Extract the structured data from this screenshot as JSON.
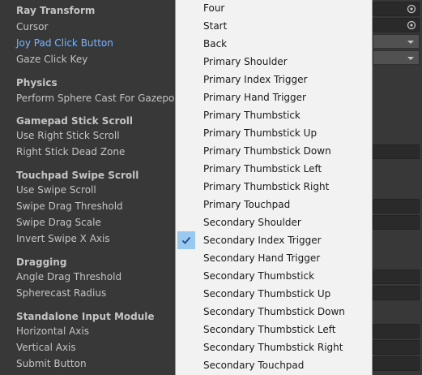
{
  "inspector": {
    "rows": [
      {
        "id": "ray-transform",
        "label": "Ray Transform",
        "type": "header"
      },
      {
        "id": "cursor",
        "label": "Cursor",
        "type": "item"
      },
      {
        "id": "joy-pad-click-button",
        "label": "Joy Pad Click Button",
        "type": "item",
        "active": true
      },
      {
        "id": "gaze-click-key",
        "label": "Gaze Click Key",
        "type": "item"
      },
      {
        "id": "physics",
        "label": "Physics",
        "type": "header"
      },
      {
        "id": "perform-sphere-cast",
        "label": "Perform Sphere Cast For Gazepoin",
        "type": "item"
      },
      {
        "id": "gamepad-stick-scroll",
        "label": "Gamepad Stick Scroll",
        "type": "header"
      },
      {
        "id": "use-right-stick-scroll",
        "label": "Use Right Stick Scroll",
        "type": "item"
      },
      {
        "id": "right-stick-dead-zone",
        "label": "Right Stick Dead Zone",
        "type": "item"
      },
      {
        "id": "touchpad-swipe-scroll",
        "label": "Touchpad Swipe Scroll",
        "type": "header"
      },
      {
        "id": "use-swipe-scroll",
        "label": "Use Swipe Scroll",
        "type": "item"
      },
      {
        "id": "swipe-drag-threshold",
        "label": "Swipe Drag Threshold",
        "type": "item"
      },
      {
        "id": "swipe-drag-scale",
        "label": "Swipe Drag Scale",
        "type": "item"
      },
      {
        "id": "invert-swipe-x-axis",
        "label": "Invert Swipe X Axis",
        "type": "item"
      },
      {
        "id": "dragging",
        "label": "Dragging",
        "type": "header"
      },
      {
        "id": "angle-drag-threshold",
        "label": "Angle Drag Threshold",
        "type": "item"
      },
      {
        "id": "spherecast-radius",
        "label": "Spherecast Radius",
        "type": "item"
      },
      {
        "id": "standalone-input-module",
        "label": "Standalone Input Module",
        "type": "header"
      },
      {
        "id": "horizontal-axis",
        "label": "Horizontal Axis",
        "type": "item"
      },
      {
        "id": "vertical-axis",
        "label": "Vertical Axis",
        "type": "item"
      },
      {
        "id": "submit-button",
        "label": "Submit Button",
        "type": "item"
      }
    ]
  },
  "dropdown_menu": {
    "selected": "Secondary Index Trigger",
    "items": [
      "Four",
      "Start",
      "Back",
      "Primary Shoulder",
      "Primary Index Trigger",
      "Primary Hand Trigger",
      "Primary Thumbstick",
      "Primary Thumbstick Up",
      "Primary Thumbstick Down",
      "Primary Thumbstick Left",
      "Primary Thumbstick Right",
      "Primary Touchpad",
      "Secondary Shoulder",
      "Secondary Index Trigger",
      "Secondary Hand Trigger",
      "Secondary Thumbstick",
      "Secondary Thumbstick Up",
      "Secondary Thumbstick Down",
      "Secondary Thumbstick Left",
      "Secondary Thumbstick Right",
      "Secondary Touchpad"
    ]
  },
  "colors": {
    "panel_bg": "#383838",
    "menu_bg": "#f2f2f2",
    "active_text": "#7fb4f5",
    "selection": "#99c9ef"
  }
}
